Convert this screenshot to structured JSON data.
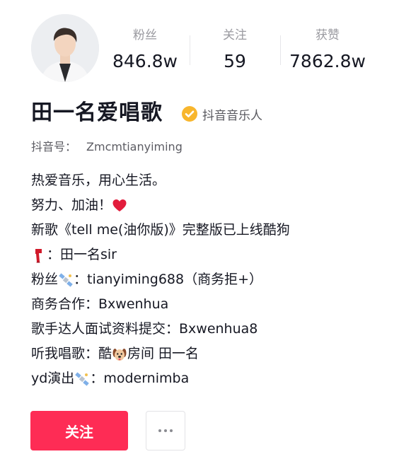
{
  "profile": {
    "name": "田一名爱唱歌",
    "verified_label": "抖音音乐人",
    "douyin_id_label": "抖音号：",
    "douyin_id": "Zmcmtianyiming"
  },
  "stats": {
    "fans_label": "粉丝",
    "fans_value": "846.8w",
    "following_label": "关注",
    "following_value": "59",
    "likes_label": "获赞",
    "likes_value": "7862.8w"
  },
  "bio": {
    "line1": "热爱音乐，用心生活。",
    "line2_text": "努力、加油！",
    "line3": "新歌《tell me(油你版)》完整版已上线酷狗",
    "line4_text": "：田一名sir",
    "line5_prefix": "粉丝",
    "line5_suffix": "：tianyiming688（商务拒+）",
    "line6": "商务合作：Bxwenhua",
    "line7": "歌手达人面试资料提交：Bxwenhua8",
    "line8_prefix": "听我唱歌：酷",
    "line8_suffix": "房间 田一名",
    "line9_prefix": "yd演出",
    "line9_suffix": "：modernimba"
  },
  "actions": {
    "follow_label": "关注"
  },
  "icons": {
    "verified": "check-badge-icon",
    "heart": "red-heart-emoji",
    "scarf": "red-scarf-emoji",
    "satellite": "satellite-emoji",
    "dog": "dog-face-emoji",
    "more": "more-dots-icon"
  },
  "colors": {
    "accent": "#fe2c55",
    "verified": "#f8b62d",
    "text_primary": "#161823",
    "text_secondary": "#9a9aa0"
  }
}
